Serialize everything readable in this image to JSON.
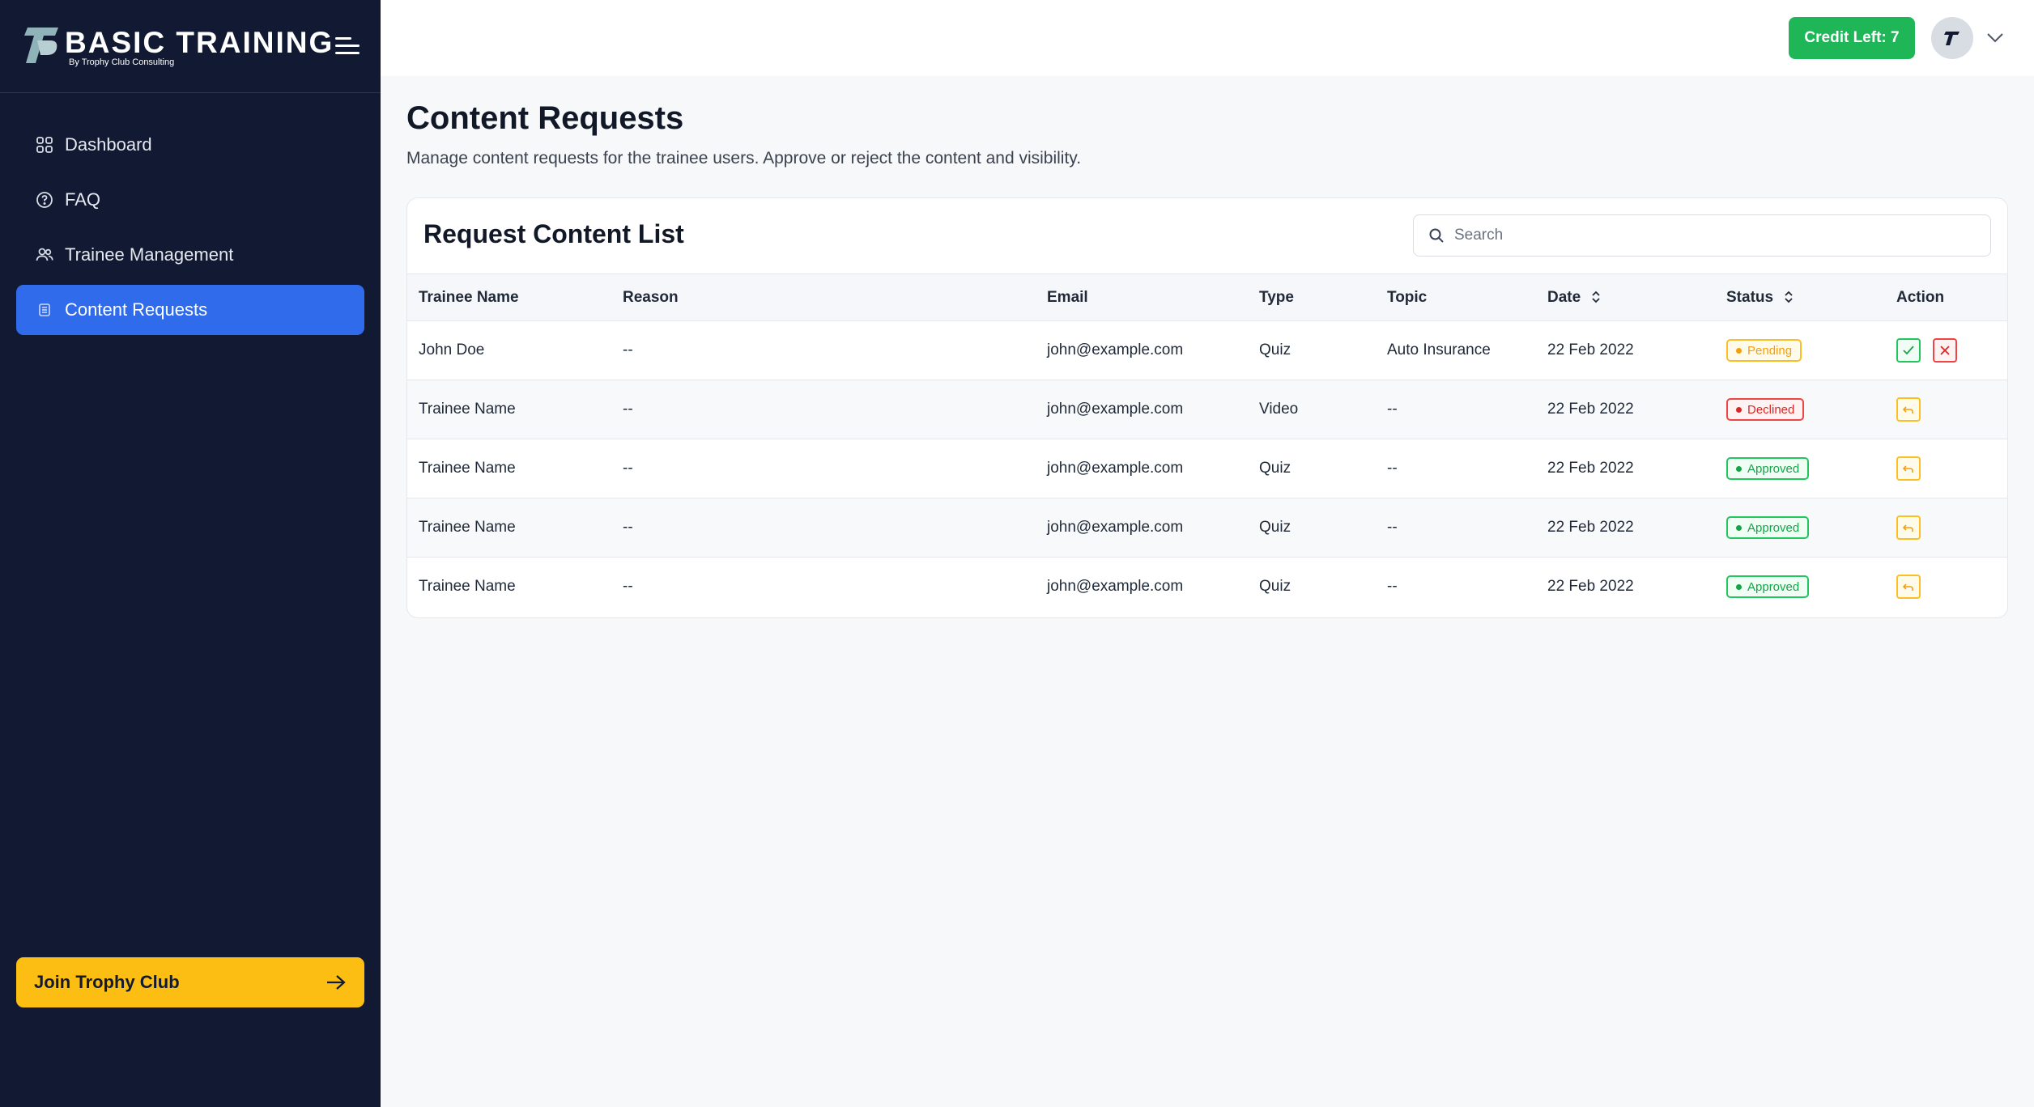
{
  "brand": {
    "title": "BASIC TRAINING",
    "subtitle": "By Trophy Club Consulting"
  },
  "sidebar": {
    "items": [
      {
        "label": "Dashboard",
        "icon": "dashboard-icon",
        "active": false
      },
      {
        "label": "FAQ",
        "icon": "question-circle-icon",
        "active": false
      },
      {
        "label": "Trainee Management",
        "icon": "users-icon",
        "active": false
      },
      {
        "label": "Content Requests",
        "icon": "document-icon",
        "active": true
      }
    ],
    "join_button": "Join Trophy Club"
  },
  "topbar": {
    "credit_label": "Credit Left: 7"
  },
  "page": {
    "title": "Content Requests",
    "description": "Manage content requests for the trainee users. Approve or reject the content and visibility."
  },
  "card": {
    "title": "Request Content List",
    "search_placeholder": "Search"
  },
  "table": {
    "headers": {
      "trainee_name": "Trainee Name",
      "reason": "Reason",
      "email": "Email",
      "type": "Type",
      "topic": "Topic",
      "date": "Date",
      "status": "Status",
      "action": "Action"
    },
    "rows": [
      {
        "name": "John Doe",
        "reason": "--",
        "email": "john@example.com",
        "type": "Quiz",
        "topic": "Auto Insurance",
        "date": "22 Feb 2022",
        "status": "Pending"
      },
      {
        "name": "Trainee Name",
        "reason": "--",
        "email": "john@example.com",
        "type": "Video",
        "topic": "--",
        "date": "22 Feb 2022",
        "status": "Declined"
      },
      {
        "name": "Trainee Name",
        "reason": "--",
        "email": "john@example.com",
        "type": "Quiz",
        "topic": "--",
        "date": "22 Feb 2022",
        "status": "Approved"
      },
      {
        "name": "Trainee Name",
        "reason": "--",
        "email": "john@example.com",
        "type": "Quiz",
        "topic": "--",
        "date": "22 Feb 2022",
        "status": "Approved"
      },
      {
        "name": "Trainee Name",
        "reason": "--",
        "email": "john@example.com",
        "type": "Quiz",
        "topic": "--",
        "date": "22 Feb 2022",
        "status": "Approved"
      }
    ]
  },
  "colors": {
    "sidebar_bg": "#111a32",
    "active_nav": "#2f6bea",
    "join_button": "#fcbe13",
    "credit_button": "#1fb657",
    "pending": "#f59e0b",
    "declined": "#dc2626",
    "approved": "#16a34a"
  }
}
